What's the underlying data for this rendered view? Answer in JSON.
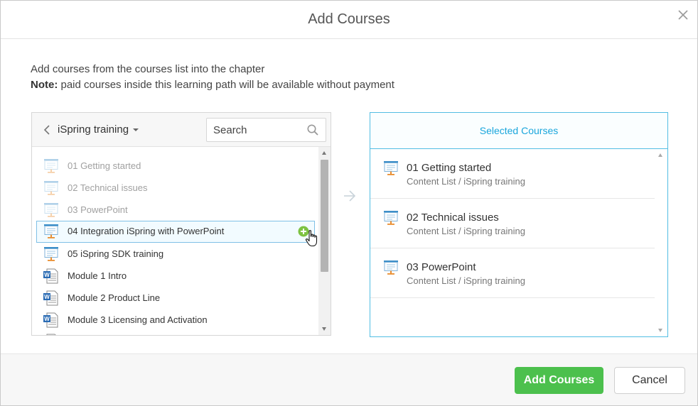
{
  "dialog": {
    "title": "Add Courses",
    "close_icon": "close-icon"
  },
  "intro": {
    "line1": "Add courses from the courses list into the chapter",
    "note_label": "Note:",
    "note_text": " paid courses inside this learning path will be available without payment"
  },
  "left_panel": {
    "folder_name": "iSpring training",
    "search": {
      "placeholder": "Search",
      "value": ""
    },
    "items": [
      {
        "label": "01 Getting started",
        "icon": "presentation-icon",
        "state": "added"
      },
      {
        "label": "02 Technical issues",
        "icon": "presentation-icon",
        "state": "added"
      },
      {
        "label": "03 PowerPoint",
        "icon": "presentation-icon",
        "state": "added"
      },
      {
        "label": "04 Integration iSpring with PowerPoint",
        "icon": "presentation-icon",
        "state": "hover"
      },
      {
        "label": "05 iSpring SDK training",
        "icon": "presentation-icon",
        "state": "normal"
      },
      {
        "label": "Module 1 Intro",
        "icon": "word-document-icon",
        "state": "normal"
      },
      {
        "label": "Module 2 Product Line",
        "icon": "word-document-icon",
        "state": "normal"
      },
      {
        "label": "Module 3 Licensing and Activation",
        "icon": "word-document-icon",
        "state": "normal"
      }
    ]
  },
  "right_panel": {
    "header": "Selected Courses",
    "items": [
      {
        "title": "01 Getting started",
        "path": "Content List / iSpring training"
      },
      {
        "title": "02 Technical issues",
        "path": "Content List / iSpring training"
      },
      {
        "title": "03 PowerPoint",
        "path": "Content List / iSpring training"
      }
    ]
  },
  "footer": {
    "add_label": "Add Courses",
    "cancel_label": "Cancel"
  },
  "colors": {
    "accent": "#1aa6dc",
    "primary_button": "#4cc04d",
    "add_icon": "#7dc242"
  }
}
